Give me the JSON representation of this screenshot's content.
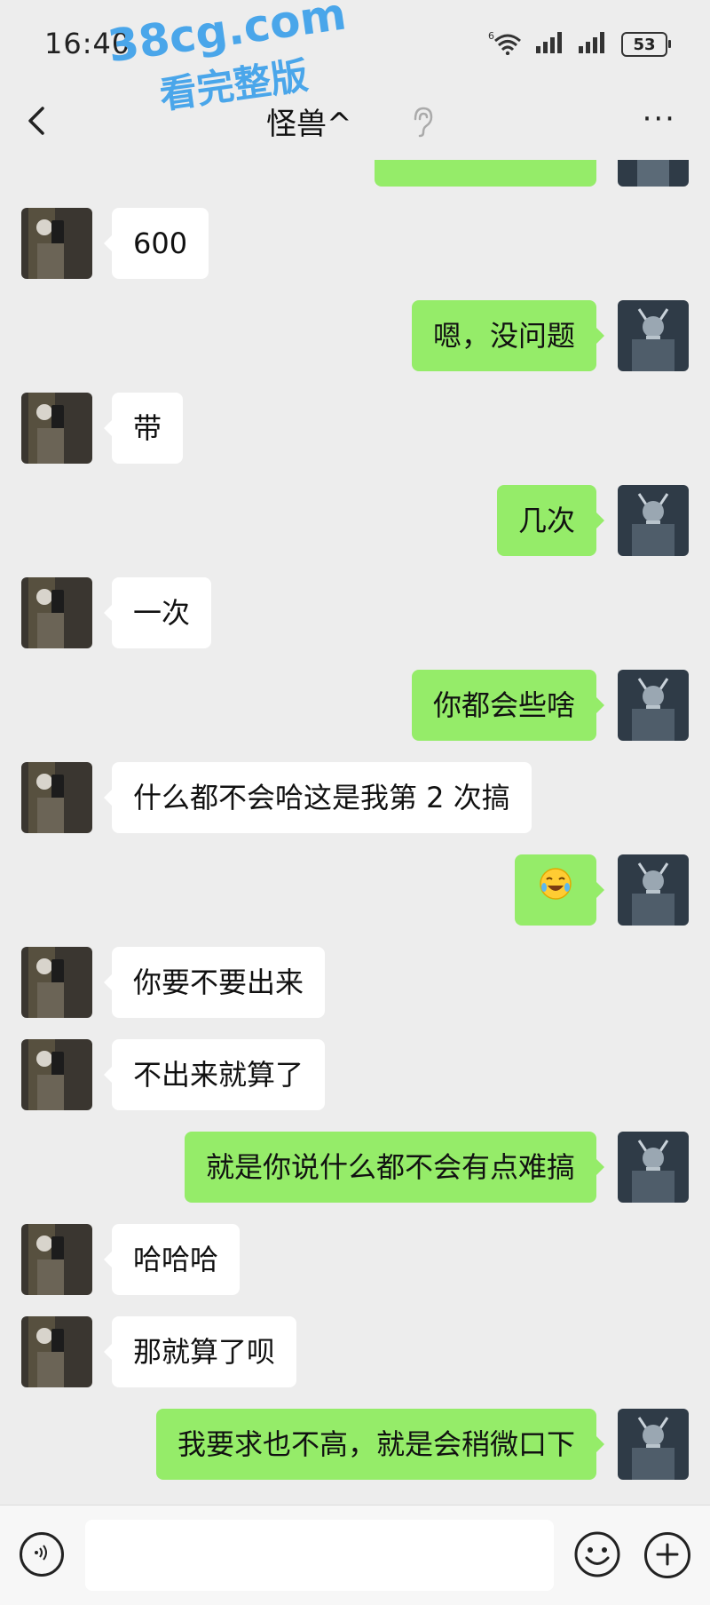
{
  "status_bar": {
    "time": "16:40",
    "network": "6",
    "battery": "53"
  },
  "watermark": {
    "line1": "38cg.com",
    "line2": "看完整版"
  },
  "header": {
    "title": "怪兽^",
    "back_icon": "chevron-left-icon",
    "more_label": "···"
  },
  "messages": [
    {
      "side": "in",
      "text": "600"
    },
    {
      "side": "out",
      "text": "嗯，没问题"
    },
    {
      "side": "in",
      "text": "带"
    },
    {
      "side": "out",
      "text": "几次"
    },
    {
      "side": "in",
      "text": "一次"
    },
    {
      "side": "out",
      "text": "你都会些啥"
    },
    {
      "side": "in",
      "text": "什么都不会哈这是我第 2 次搞"
    },
    {
      "side": "out",
      "text": "",
      "emoji": "laughing-crying-emoji"
    },
    {
      "side": "in",
      "text": "你要不要出来"
    },
    {
      "side": "in",
      "text": "不出来就算了"
    },
    {
      "side": "out",
      "text": "就是你说什么都不会有点难搞"
    },
    {
      "side": "in",
      "text": "哈哈哈"
    },
    {
      "side": "in",
      "text": "那就算了呗"
    },
    {
      "side": "out",
      "text": "我要求也不高，就是会稍微口下"
    }
  ],
  "input_bar": {
    "placeholder": ""
  },
  "colors": {
    "outgoing": "#95ec69",
    "incoming": "#ffffff",
    "background": "#ededed",
    "watermark": "#4aa6ea"
  }
}
